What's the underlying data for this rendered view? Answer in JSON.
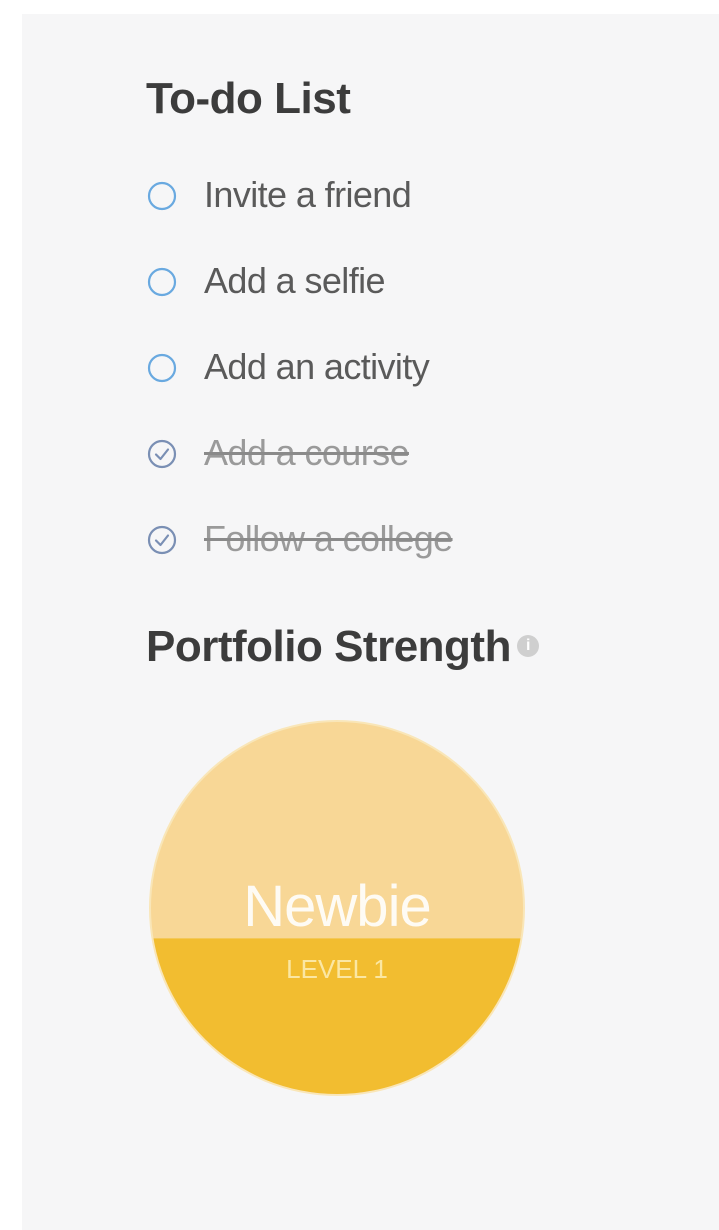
{
  "todo": {
    "title": "To-do List",
    "items": [
      {
        "label": "Invite a friend",
        "done": false
      },
      {
        "label": "Add a selfie",
        "done": false
      },
      {
        "label": "Add an activity",
        "done": false
      },
      {
        "label": "Add a course",
        "done": true
      },
      {
        "label": "Follow a college",
        "done": true
      }
    ]
  },
  "strength": {
    "title": "Portfolio Strength",
    "info_icon": "i",
    "badge": {
      "title": "Newbie",
      "level": "LEVEL 1",
      "fill_fraction": 0.42
    }
  },
  "colors": {
    "panel_bg": "#f6f6f7",
    "heading": "#3c3c3c",
    "unchecked": "#3a8fd8",
    "checked": "#7a8fb4",
    "badge_light": "#f8d796",
    "badge_dark": "#f2bd30",
    "badge_ring": "#f9e6b8"
  }
}
